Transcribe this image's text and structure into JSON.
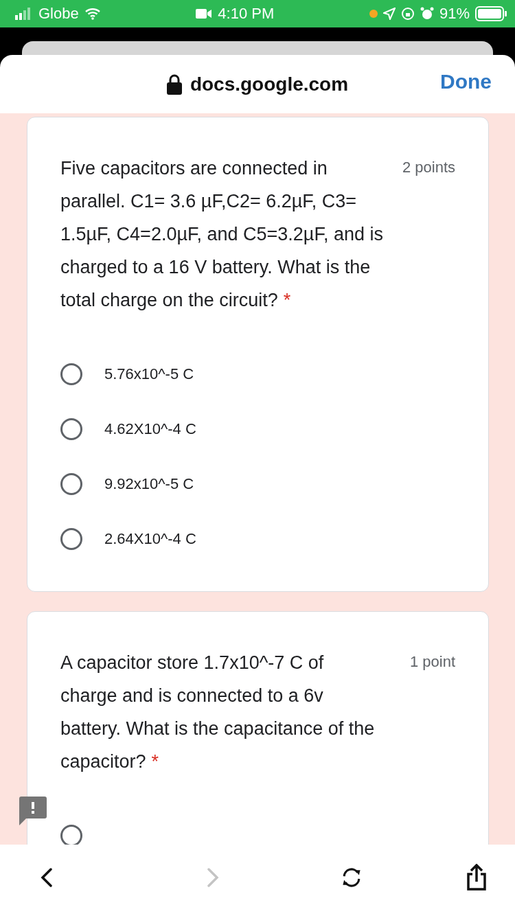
{
  "status_bar": {
    "carrier": "Globe",
    "time": "4:10 PM",
    "battery": "91%"
  },
  "browser": {
    "url": "docs.google.com",
    "done": "Done"
  },
  "questions": [
    {
      "text": "Five capacitors are connected in parallel. C1= 3.6 µF,C2= 6.2µF, C3= 1.5µF, C4=2.0µF, and C5=3.2µF, and is charged to a 16 V battery. What is the total charge on the circuit?",
      "required_mark": "*",
      "points": "2 points",
      "options": [
        {
          "label": "5.76x10^-5 C",
          "selected": false
        },
        {
          "label": "4.62X10^-4 C",
          "selected": false
        },
        {
          "label": "9.92x10^-5 C",
          "selected": false
        },
        {
          "label": "2.64X10^-4 C",
          "selected": false
        }
      ]
    },
    {
      "text": "A capacitor store 1.7x10^-7 C of charge and is connected to a 6v battery. What is the capacitance of the capacitor?",
      "required_mark": "*",
      "points": "1 point",
      "options": [
        {
          "selected": false
        }
      ]
    }
  ]
}
